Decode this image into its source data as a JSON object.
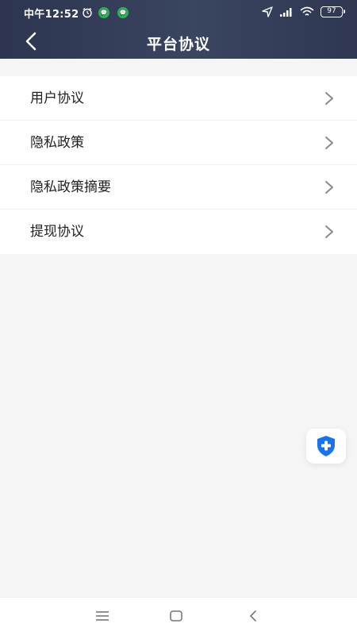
{
  "status_bar": {
    "time": "中午12:52",
    "battery": "97",
    "icons": [
      "alarm-icon",
      "message-icon",
      "message-icon",
      "location-icon",
      "signal-icon",
      "wifi-icon",
      "battery-icon"
    ]
  },
  "header": {
    "title": "平台协议",
    "back_icon": "back-chevron-icon"
  },
  "menu": {
    "items": [
      {
        "label": "用户协议"
      },
      {
        "label": "隐私政策"
      },
      {
        "label": "隐私政策摘要"
      },
      {
        "label": "提现协议"
      }
    ]
  },
  "floating_action": {
    "icon": "shield-plus-icon"
  },
  "nav_bar": {
    "icons": [
      "menu-icon",
      "home-icon",
      "back-icon"
    ]
  },
  "colors": {
    "header_bg": "#363f5a",
    "page_bg": "#f5f5f5",
    "shield_blue": "#1a73e8"
  }
}
